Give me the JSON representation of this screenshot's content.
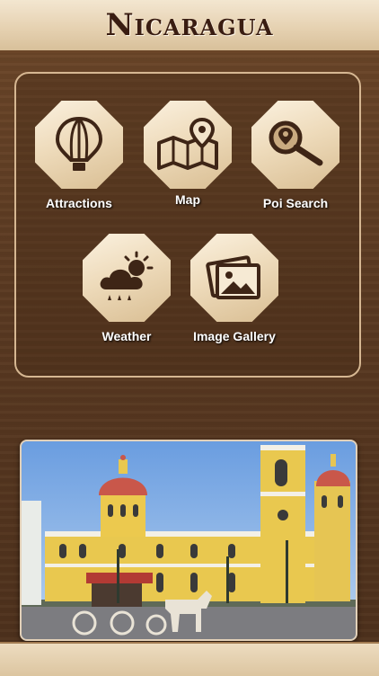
{
  "header": {
    "title": "Nicaragua"
  },
  "menu": {
    "items": [
      {
        "label": "Attractions",
        "icon": "hot-air-balloon-icon"
      },
      {
        "label": "Map",
        "icon": "map-pin-icon"
      },
      {
        "label": "Poi Search",
        "icon": "poi-search-icon"
      },
      {
        "label": "Weather",
        "icon": "weather-icon"
      },
      {
        "label": "Image Gallery",
        "icon": "image-gallery-icon"
      }
    ]
  },
  "photo": {
    "subject": "cathedral-photo"
  },
  "colors": {
    "wood": "#5a3a22",
    "tile_light": "#fbf1df",
    "tile_dark": "#d9be93",
    "icon": "#3e2516",
    "panel_border": "#d6b792"
  }
}
